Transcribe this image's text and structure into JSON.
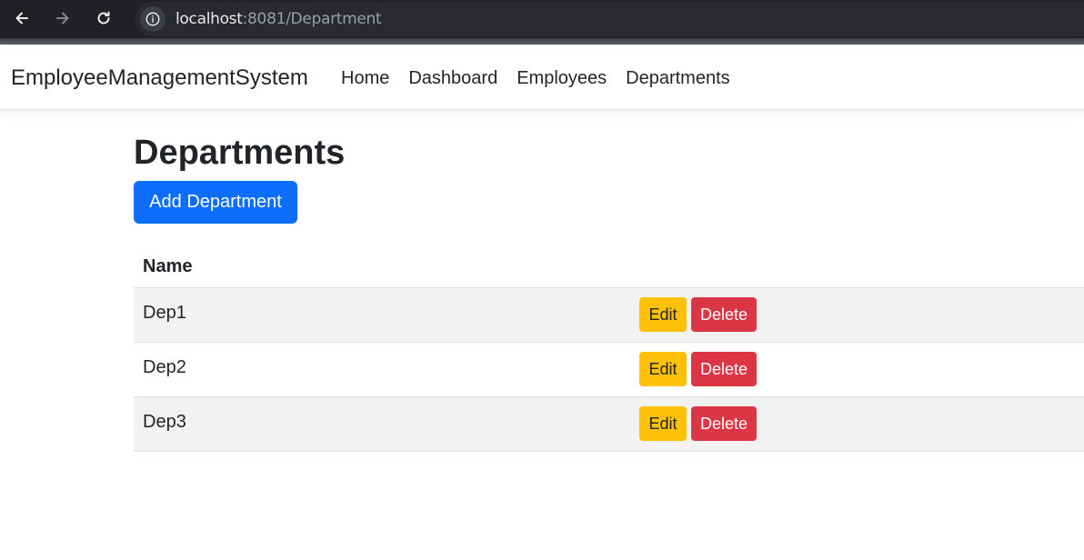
{
  "browser": {
    "url_host": "localhost",
    "url_rest": ":8081/Department",
    "icons": [
      "back-arrow-icon",
      "forward-arrow-icon",
      "reload-icon",
      "info-icon"
    ]
  },
  "navbar": {
    "brand": "EmployeeManagementSystem",
    "links": [
      "Home",
      "Dashboard",
      "Employees",
      "Departments"
    ]
  },
  "page": {
    "title": "Departments",
    "add_button": "Add Department"
  },
  "table": {
    "header": "Name",
    "rows": [
      {
        "name": "Dep1",
        "edit": "Edit",
        "delete": "Delete"
      },
      {
        "name": "Dep2",
        "edit": "Edit",
        "delete": "Delete"
      },
      {
        "name": "Dep3",
        "edit": "Edit",
        "delete": "Delete"
      }
    ]
  },
  "colors": {
    "primary": "#0d6efd",
    "warning": "#ffc107",
    "danger": "#dc3545",
    "stripe": "#f2f2f2"
  }
}
